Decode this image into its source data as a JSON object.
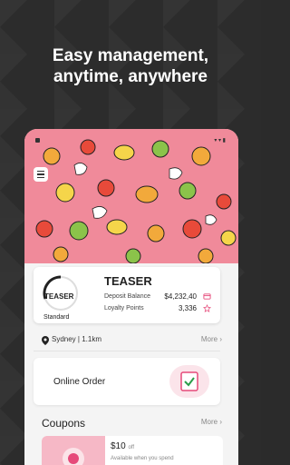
{
  "headline": {
    "line1": "Easy management,",
    "line2": "anytime, anywhere"
  },
  "status_bar": {
    "right_text": "▾ ▾ ▮"
  },
  "membership_card": {
    "brand_label": "TEASER",
    "tier": "Standard",
    "title": "TEASER",
    "deposit_label": "Deposit Balance",
    "deposit_value": "$4,232,40",
    "points_label": "Loyalty Points",
    "points_value": "3,336"
  },
  "location": {
    "text": "Sydney | 1.1km",
    "more_label": "More"
  },
  "online_order": {
    "label": "Online Order"
  },
  "coupons": {
    "title": "Coupons",
    "more_label": "More",
    "first_value": "$10",
    "first_suffix": "off",
    "first_desc": "Available when you spend"
  },
  "colors": {
    "hero_pink": "#f08a9a",
    "accent_pink": "#e64a7a",
    "check_green": "#2a9d4a"
  }
}
